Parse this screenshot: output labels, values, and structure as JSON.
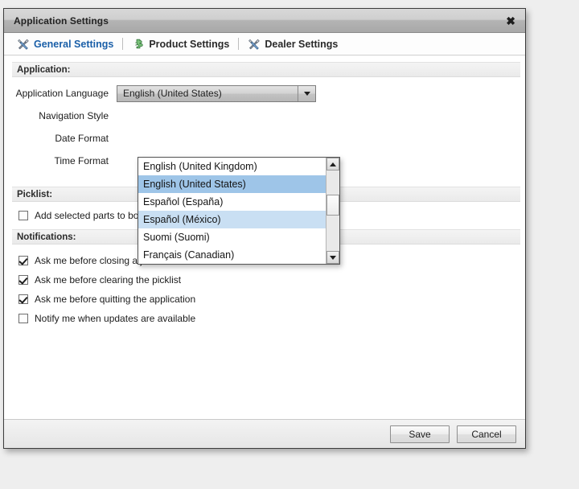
{
  "window": {
    "title": "Application Settings",
    "close_label": "✖"
  },
  "tabs": [
    {
      "label": "General Settings",
      "icon": "tools-icon",
      "active": true
    },
    {
      "label": "Product Settings",
      "icon": "puzzle-icon",
      "active": false
    },
    {
      "label": "Dealer Settings",
      "icon": "tools-icon",
      "active": false
    }
  ],
  "sections": {
    "application": {
      "header": "Application:",
      "rows": [
        {
          "label": "Application Language",
          "value": "English (United States)"
        },
        {
          "label": "Navigation Style",
          "value": ""
        },
        {
          "label": "Date Format",
          "value": ""
        },
        {
          "label": "Time Format",
          "value": ""
        }
      ]
    },
    "picklist": {
      "header": "Picklist:",
      "checkboxes": [
        {
          "label": "Add selected parts to bottom of picklist",
          "checked": false
        }
      ]
    },
    "notifications": {
      "header": "Notifications:",
      "checkboxes": [
        {
          "label": "Ask me before closing a job tab",
          "checked": true
        },
        {
          "label": "Ask me before clearing the picklist",
          "checked": true
        },
        {
          "label": "Ask me before quitting the application",
          "checked": true
        },
        {
          "label": "Notify me when updates are available",
          "checked": false
        }
      ]
    }
  },
  "dropdown": {
    "open": true,
    "selected_value": "English (United States)",
    "options": [
      {
        "label": "English (United Kingdom)",
        "state": "normal"
      },
      {
        "label": "English (United States)",
        "state": "selected"
      },
      {
        "label": "Español (España)",
        "state": "normal"
      },
      {
        "label": "Español (México)",
        "state": "hover"
      },
      {
        "label": "Suomi (Suomi)",
        "state": "normal"
      },
      {
        "label": "Français (Canadian)",
        "state": "normal"
      }
    ],
    "scrollbar": {
      "up_icon": "triangle-up-icon",
      "down_icon": "triangle-down-icon"
    }
  },
  "footer": {
    "save_label": "Save",
    "cancel_label": "Cancel"
  },
  "colors": {
    "accent_tab_active": "#1a5fa8",
    "selected_row": "#9ec5e8",
    "hover_row": "#c9dff3",
    "page_background": "#eeeeee",
    "dialog_background": "#ffffff"
  }
}
